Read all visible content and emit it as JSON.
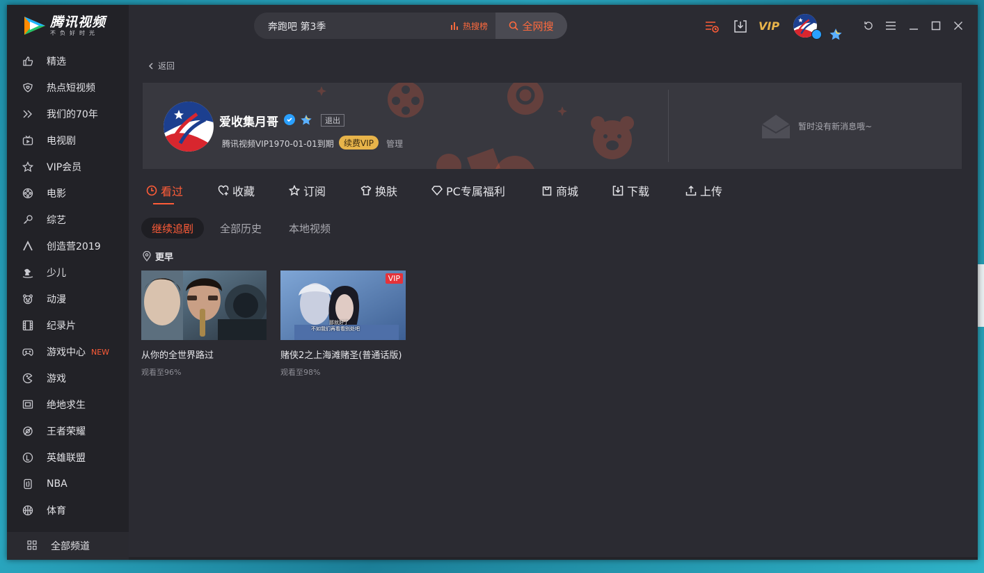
{
  "app": {
    "logo_title": "腾讯视频",
    "logo_subtitle": "不负好时光",
    "brand_color": "#ff5c38",
    "vip_color": "#e8b44a"
  },
  "search": {
    "query": "奔跑吧 第3季",
    "hot_label": "热搜榜",
    "button_label": "全网搜"
  },
  "topbar": {
    "vip_label": "VIP"
  },
  "sidebar": {
    "items": [
      {
        "label": "精选",
        "icon": "thumbs-up-icon"
      },
      {
        "label": "热点短视频",
        "icon": "heart-shield-icon"
      },
      {
        "label": "我们的70年",
        "icon": "double-chevron-icon"
      },
      {
        "label": "电视剧",
        "icon": "tv-icon"
      },
      {
        "label": "VIP会员",
        "icon": "star-outline-icon"
      },
      {
        "label": "电影",
        "icon": "film-reel-icon"
      },
      {
        "label": "综艺",
        "icon": "microphone-icon"
      },
      {
        "label": "创造营2019",
        "icon": "caret-up-icon"
      },
      {
        "label": "少儿",
        "icon": "rocking-horse-icon"
      },
      {
        "label": "动漫",
        "icon": "bear-face-icon"
      },
      {
        "label": "纪录片",
        "icon": "film-strip-icon"
      },
      {
        "label": "游戏中心",
        "icon": "gamepad-icon",
        "badge": "NEW"
      },
      {
        "label": "游戏",
        "icon": "pacman-icon"
      },
      {
        "label": "绝地求生",
        "icon": "crate-icon"
      },
      {
        "label": "王者荣耀",
        "icon": "crosshair-icon"
      },
      {
        "label": "英雄联盟",
        "icon": "shield-l-icon"
      },
      {
        "label": "NBA",
        "icon": "jersey-icon"
      },
      {
        "label": "体育",
        "icon": "basketball-icon"
      }
    ],
    "all_channels": "全部频道"
  },
  "main": {
    "back_label": "返回",
    "profile": {
      "username": "爱收集月哥",
      "logout_label": "退出",
      "expire_text": "腾讯视频VIP1970-01-01到期",
      "renew_label": "续费VIP",
      "manage_label": "管理",
      "message_text": "暂时没有新消息哦~"
    },
    "tabs": [
      {
        "label": "看过",
        "icon": "clock-icon",
        "active": true
      },
      {
        "label": "收藏",
        "icon": "heart-plus-icon"
      },
      {
        "label": "订阅",
        "icon": "star-icon"
      },
      {
        "label": "换肤",
        "icon": "tshirt-icon"
      },
      {
        "label": "PC专属福利",
        "icon": "diamond-icon"
      },
      {
        "label": "商城",
        "icon": "shopping-bag-icon"
      },
      {
        "label": "下载",
        "icon": "download-icon"
      },
      {
        "label": "上传",
        "icon": "upload-icon"
      }
    ],
    "subtabs": [
      {
        "label": "继续追剧",
        "active": true
      },
      {
        "label": "全部历史"
      },
      {
        "label": "本地视频"
      }
    ],
    "section_label": "更早",
    "videos": [
      {
        "title": "从你的全世界路过",
        "progress": "观看至96%",
        "vip": false
      },
      {
        "title": "赌侠2之上海滩赌圣(普通话版)",
        "progress": "观看至98%",
        "vip": true,
        "vip_label": "VIP",
        "subtitle_line1": "那就好了",
        "subtitle_line2": "不如我们再看看别处吧"
      }
    ]
  }
}
